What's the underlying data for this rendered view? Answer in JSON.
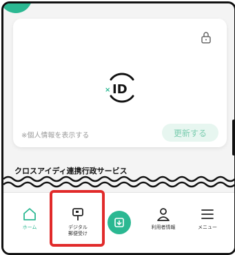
{
  "app": {
    "badge_color": "#2bb892"
  },
  "card": {
    "logo_icon": "xid-logo-icon",
    "lock_icon": "lock-icon",
    "privacy_text": "※個人情報を表示する",
    "update_button_label": "更新する"
  },
  "section": {
    "title": "クロスアイディ連携行政サービス"
  },
  "tabbar": {
    "items": [
      {
        "label": "ホーム",
        "icon": "home-icon",
        "active": true
      },
      {
        "label": "デジタル\n郵便受け",
        "icon": "mailbox-icon",
        "active": false
      },
      {
        "label": "",
        "icon": "center-action-icon",
        "active": false
      },
      {
        "label": "利用者情報",
        "icon": "user-icon",
        "active": false
      },
      {
        "label": "メニュー",
        "icon": "menu-icon",
        "active": false
      }
    ],
    "highlight_color": "#e12a2a"
  }
}
